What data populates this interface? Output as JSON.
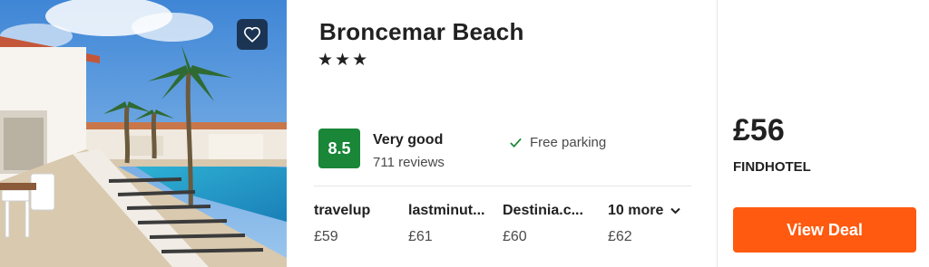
{
  "hotel": {
    "name": "Broncemar Beach",
    "stars": "★★★",
    "rating": {
      "score": "8.5",
      "label": "Very good",
      "reviews": "711 reviews",
      "color": "#198638"
    },
    "amenity": {
      "icon": "checkmark-icon",
      "label": "Free parking",
      "color": "#198638"
    },
    "favorite_icon": "heart-icon"
  },
  "providers": [
    {
      "name": "travelup",
      "price": "£59"
    },
    {
      "name": "lastminut...",
      "price": "£61"
    },
    {
      "name": "Destinia.c...",
      "price": "£60"
    },
    {
      "name": "10 more",
      "price": "£62",
      "icon": "chevron-down-icon"
    }
  ],
  "deal": {
    "price": "£56",
    "provider": "FINDHOTEL",
    "button_label": "View Deal",
    "button_color": "#ff5a0f"
  }
}
